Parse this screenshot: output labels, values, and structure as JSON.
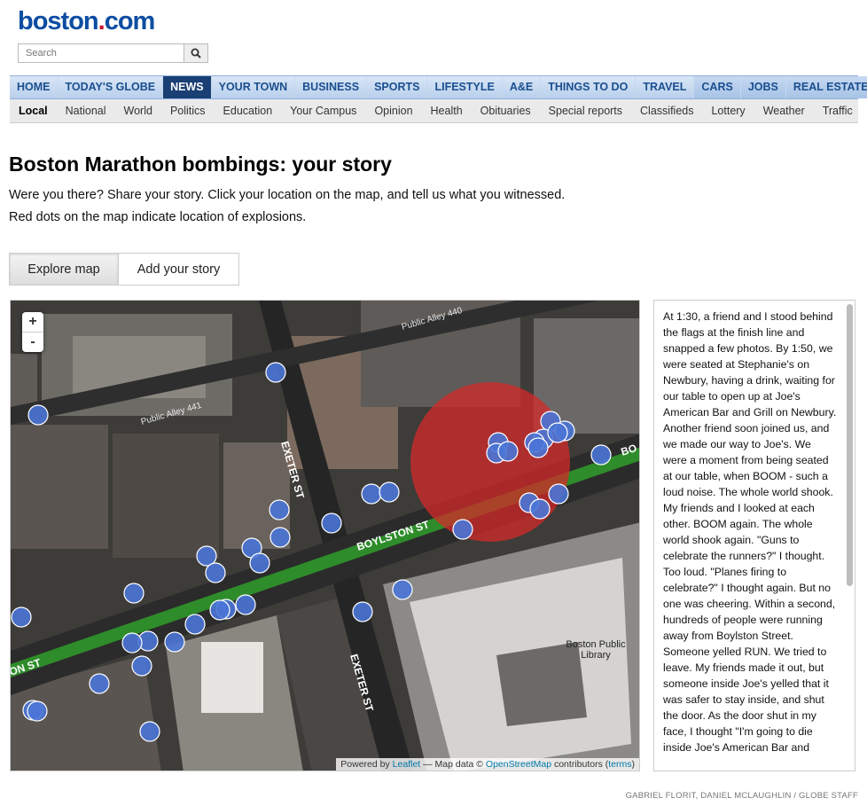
{
  "site": {
    "logo_main": "boston",
    "logo_dot": ".",
    "logo_tld": "com"
  },
  "search": {
    "placeholder": "Search",
    "icon": "search-icon"
  },
  "nav": {
    "items": [
      "HOME",
      "TODAY'S GLOBE",
      "NEWS",
      "YOUR TOWN",
      "BUSINESS",
      "SPORTS",
      "LIFESTYLE",
      "A&E",
      "THINGS TO DO",
      "TRAVEL",
      "CARS",
      "JOBS",
      "REAL ESTATE"
    ],
    "active": "NEWS"
  },
  "subnav": {
    "items": [
      "Local",
      "National",
      "World",
      "Politics",
      "Education",
      "Your Campus",
      "Opinion",
      "Health",
      "Obituaries",
      "Special reports",
      "Classifieds",
      "Lottery",
      "Weather",
      "Traffic"
    ],
    "active": "Local"
  },
  "page": {
    "title": "Boston Marathon bombings: your story",
    "intro1": "Were you there? Share your story. Click your location on the map, and tell us what you witnessed.",
    "intro2": "Red dots on the map indicate location of explosions."
  },
  "tabs": {
    "explore": "Explore map",
    "add": "Add your story"
  },
  "map": {
    "zoom_in": "+",
    "zoom_out": "-",
    "labels": {
      "alley440": "Public Alley 440",
      "alley441": "Public Alley 441",
      "exeter_top": "EXETER ST",
      "exeter_bottom": "EXETER ST",
      "boylston_center": "BOYLSTON ST",
      "boylston_left": "ON ST",
      "boylston_right": "BO",
      "library1": "Boston Public",
      "library2": "Library"
    },
    "attribution": {
      "powered": "Powered by",
      "leaflet": "Leaflet",
      "mid": "— Map data ©",
      "osm": "OpenStreetMap",
      "contributors": "contributors (",
      "terms": "terms",
      "close": ")"
    },
    "colors": {
      "story_marker": "#4a74d6",
      "explosion": "#d42a2a",
      "street": "#2f9e2a"
    }
  },
  "story": {
    "text": "At 1:30, a friend and I stood behind the flags at the finish line and snapped a few photos. By 1:50, we were seated at Stephanie's on Newbury, having a drink, waiting for our table to open up at Joe's American Bar and Grill on Newbury. Another friend soon joined us, and we made our way to Joe's. We were a moment from being seated at our table, when BOOM - such a loud noise. The whole world shook. My friends and I looked at each other. BOOM again. The whole world shook again. \"Guns to celebrate the runners?\" I thought. Too loud. \"Planes firing to celebrate?\" I thought again. But no one was cheering. Within a second, hundreds of people were running away from Boylston Street. Someone yelled RUN. We tried to leave. My friends made it out, but someone inside Joe's yelled that it was safer to stay inside, and shut the door. As the door shut in my face, I thought \"I'm going to die inside Joe's American Bar and"
  },
  "credit": "GABRIEL FLORIT, DANIEL MCLAUGHLIN / GLOBE STAFF"
}
